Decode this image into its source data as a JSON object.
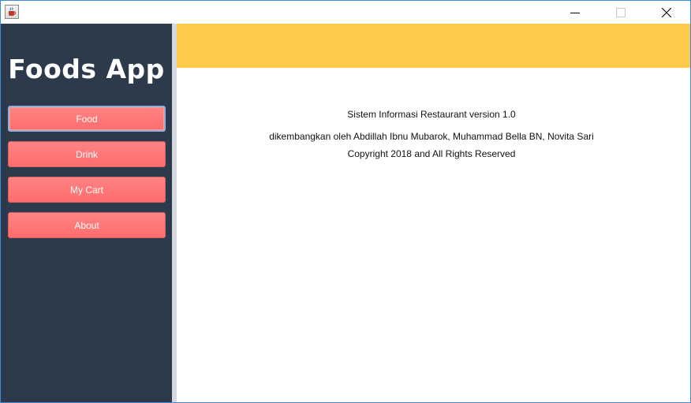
{
  "window": {
    "controls": {
      "minimize_icon": "minimize-icon",
      "maximize_icon": "maximize-icon",
      "close_icon": "close-icon"
    },
    "app_icon": "java-cup-icon"
  },
  "sidebar": {
    "title": "Foods App",
    "background_color": "#2c3a4b",
    "items": [
      {
        "label": "Food",
        "active": true
      },
      {
        "label": "Drink",
        "active": false
      },
      {
        "label": "My Cart",
        "active": false
      },
      {
        "label": "About",
        "active": false
      }
    ],
    "button_color": "#ff7575"
  },
  "main": {
    "header_color": "#ffc94a",
    "about": {
      "line1": "Sistem Informasi Restaurant version 1.0",
      "line2": "dikembangkan oleh Abdillah Ibnu Mubarok, Muhammad Bella BN, Novita Sari",
      "line3": "Copyright 2018 and All Rights Reserved"
    }
  }
}
